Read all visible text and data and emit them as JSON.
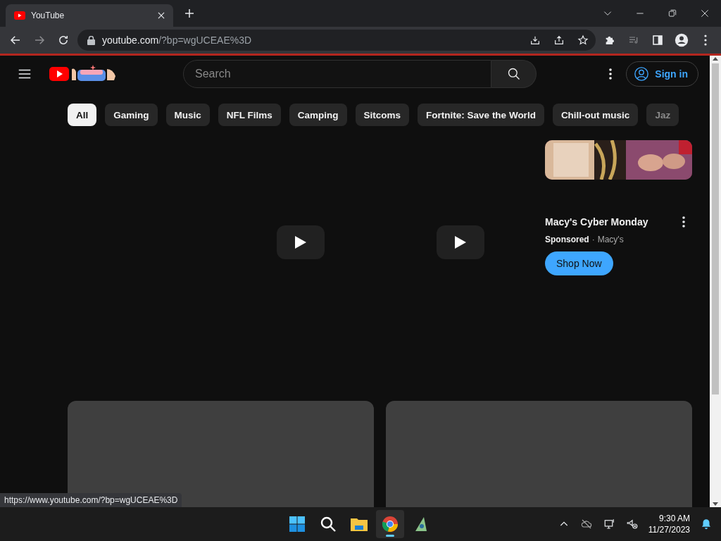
{
  "browser": {
    "tab": {
      "title": "YouTube"
    },
    "address": {
      "host": "youtube.com",
      "path": "/?bp=wgUCEAE%3D"
    },
    "status_url": "https://www.youtube.com/?bp=wgUCEAE%3D"
  },
  "header": {
    "search": {
      "placeholder": "Search"
    },
    "sign_in": "Sign in"
  },
  "chips": [
    {
      "label": "All",
      "selected": true
    },
    {
      "label": "Gaming",
      "selected": false
    },
    {
      "label": "Music",
      "selected": false
    },
    {
      "label": "NFL Films",
      "selected": false
    },
    {
      "label": "Camping",
      "selected": false
    },
    {
      "label": "Sitcoms",
      "selected": false
    },
    {
      "label": "Fortnite: Save the World",
      "selected": false
    },
    {
      "label": "Chill-out music",
      "selected": false
    },
    {
      "label": "Jaz",
      "selected": false
    }
  ],
  "ad": {
    "title": "Macy's Cyber Monday",
    "sponsored": "Sponsored",
    "separator": "·",
    "advertiser": "Macy's",
    "button": "Shop Now"
  },
  "taskbar": {
    "apps": [
      {
        "kind": "start",
        "selected": false
      },
      {
        "kind": "search",
        "selected": false
      },
      {
        "kind": "files",
        "selected": false
      },
      {
        "kind": "chrome",
        "selected": true
      },
      {
        "kind": "app",
        "selected": false
      }
    ],
    "time": "9:30 AM",
    "date": "11/27/2023"
  }
}
